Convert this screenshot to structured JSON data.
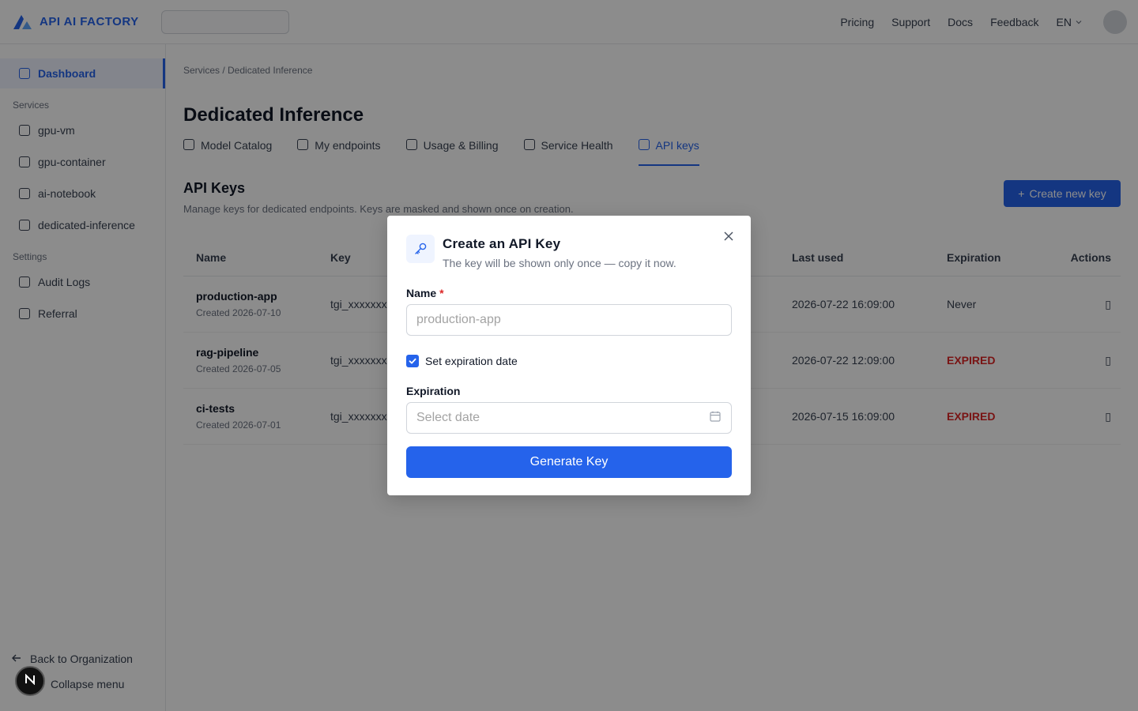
{
  "topbar": {
    "brand": "API AI FACTORY",
    "nav": [
      "Pricing",
      "Support",
      "Docs",
      "Feedback"
    ],
    "language": "EN"
  },
  "sidebar": {
    "dashboard": "Dashboard",
    "groups": [
      {
        "label": "Services",
        "items": [
          "gpu-vm",
          "gpu-container",
          "ai-notebook",
          "dedicated-inference"
        ]
      },
      {
        "label": "Settings",
        "items": [
          "Audit Logs",
          "Referral"
        ]
      }
    ],
    "back_label": "Back to Organization",
    "collapse_label": "Collapse menu"
  },
  "main": {
    "breadcrumb": "Services / Dedicated Inference",
    "title": "Dedicated Inference",
    "tabs": [
      "Model Catalog",
      "My endpoints",
      "Usage & Billing",
      "Service Health",
      "API keys"
    ],
    "section_title": "API Keys",
    "section_sub": "Manage keys for dedicated endpoints. Keys are masked and shown once on creation.",
    "create_button": "Create new key",
    "table": {
      "headers": [
        "Name",
        "Key",
        "Last used",
        "Expiration",
        "Actions"
      ],
      "rows": [
        {
          "name": "production-app",
          "created": "Created 2026-07-10",
          "key": "tgi_xxxxxxxxx",
          "last_used": "2026-07-22 16:09:00",
          "expiration": "Never",
          "expired": false
        },
        {
          "name": "rag-pipeline",
          "created": "Created 2026-07-05",
          "key": "tgi_xxxxxxxxx",
          "last_used": "2026-07-22 12:09:00",
          "expiration": "EXPIRED",
          "expired": true
        },
        {
          "name": "ci-tests",
          "created": "Created 2026-07-01",
          "key": "tgi_xxxxxxxxx",
          "last_used": "2026-07-15 16:09:00",
          "expiration": "EXPIRED",
          "expired": true
        }
      ]
    }
  },
  "modal": {
    "title": "Create an API Key",
    "subtitle": "The key will be shown only once — copy it now.",
    "name_label": "Name",
    "name_required_mark": "*",
    "name_placeholder": "production-app",
    "name_value": "",
    "expiration_checkbox_label": "Set expiration date",
    "expiration_checked": true,
    "expiration_label": "Expiration",
    "expiration_placeholder": "Select date",
    "generate_button": "Generate Key"
  },
  "colors": {
    "accent": "#2563eb",
    "danger": "#dc2626",
    "overlay": "rgba(0,0,0,0.45)"
  }
}
